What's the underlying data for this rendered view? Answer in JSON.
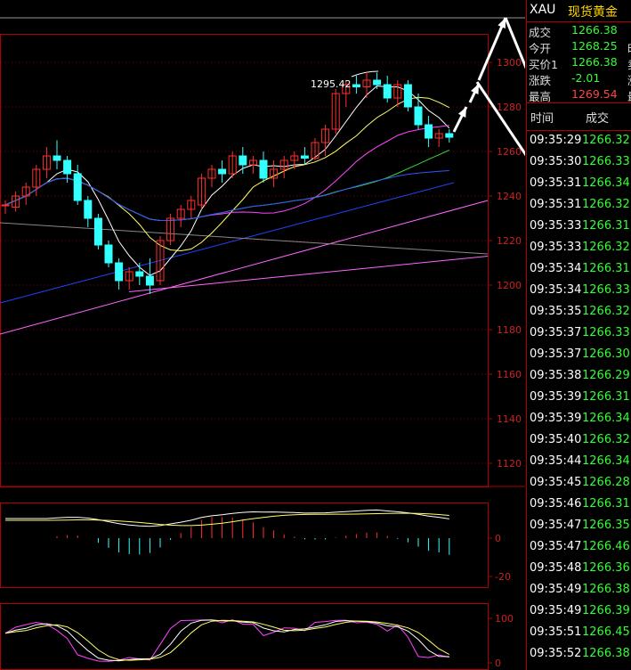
{
  "quote": {
    "symbol": "XAU",
    "name": "现货黄金",
    "rows": [
      {
        "label": "成交",
        "value": "1266.38",
        "extra": "",
        "color": "green"
      },
      {
        "label": "今开",
        "value": "1268.25",
        "extra": "时",
        "color": "green"
      },
      {
        "label": "买价1",
        "value": "1266.38",
        "extra": "卖",
        "color": "green"
      },
      {
        "label": "涨跌",
        "value": "-2.01",
        "extra": "涨",
        "color": "green"
      },
      {
        "label": "最高",
        "value": "1269.54",
        "extra": "最",
        "color": "red"
      }
    ],
    "col_time": "时间",
    "col_price": "成交"
  },
  "ticks": [
    {
      "time": "09:35:29",
      "price": "1266.32"
    },
    {
      "time": "09:35:30",
      "price": "1266.33"
    },
    {
      "time": "09:35:31",
      "price": "1266.34"
    },
    {
      "time": "09:35:31",
      "price": "1266.32"
    },
    {
      "time": "09:35:33",
      "price": "1266.31"
    },
    {
      "time": "09:35:33",
      "price": "1266.32"
    },
    {
      "time": "09:35:34",
      "price": "1266.31"
    },
    {
      "time": "09:35:34",
      "price": "1266.33"
    },
    {
      "time": "09:35:35",
      "price": "1266.32"
    },
    {
      "time": "09:35:37",
      "price": "1266.33"
    },
    {
      "time": "09:35:37",
      "price": "1266.30"
    },
    {
      "time": "09:35:38",
      "price": "1266.29"
    },
    {
      "time": "09:35:39",
      "price": "1266.31"
    },
    {
      "time": "09:35:39",
      "price": "1266.34"
    },
    {
      "time": "09:35:40",
      "price": "1266.32"
    },
    {
      "time": "09:35:44",
      "price": "1266.34"
    },
    {
      "time": "09:35:45",
      "price": "1266.28"
    },
    {
      "time": "09:35:46",
      "price": "1266.31"
    },
    {
      "time": "09:35:47",
      "price": "1266.35"
    },
    {
      "time": "09:35:47",
      "price": "1266.46"
    },
    {
      "time": "09:35:48",
      "price": "1266.36"
    },
    {
      "time": "09:35:49",
      "price": "1266.38"
    },
    {
      "time": "09:35:49",
      "price": "1266.39"
    },
    {
      "time": "09:35:51",
      "price": "1266.45"
    },
    {
      "time": "09:35:52",
      "price": "1266.38"
    }
  ],
  "chart_data": {
    "type": "candlestick",
    "price_axis": {
      "ylim": [
        1110,
        1312
      ],
      "ticks": [
        "1300",
        "1280",
        "1260",
        "1240",
        "1220",
        "1200",
        "1180",
        "1160",
        "1140",
        "1120"
      ]
    },
    "annotation": "1295.42",
    "candles": [
      [
        1236,
        1238,
        1232,
        1236
      ],
      [
        1235,
        1242,
        1233,
        1240
      ],
      [
        1240,
        1246,
        1236,
        1244
      ],
      [
        1244,
        1254,
        1240,
        1252
      ],
      [
        1252,
        1262,
        1248,
        1258
      ],
      [
        1258,
        1265,
        1252,
        1256
      ],
      [
        1256,
        1258,
        1246,
        1250
      ],
      [
        1250,
        1254,
        1236,
        1238
      ],
      [
        1238,
        1240,
        1226,
        1230
      ],
      [
        1230,
        1232,
        1216,
        1218
      ],
      [
        1218,
        1220,
        1208,
        1210
      ],
      [
        1210,
        1212,
        1198,
        1202
      ],
      [
        1202,
        1208,
        1198,
        1206
      ],
      [
        1206,
        1210,
        1200,
        1204
      ],
      [
        1204,
        1212,
        1196,
        1200
      ],
      [
        1202,
        1222,
        1200,
        1220
      ],
      [
        1220,
        1232,
        1218,
        1230
      ],
      [
        1230,
        1236,
        1226,
        1234
      ],
      [
        1234,
        1240,
        1230,
        1238
      ],
      [
        1236,
        1250,
        1234,
        1248
      ],
      [
        1248,
        1254,
        1244,
        1252
      ],
      [
        1252,
        1256,
        1246,
        1250
      ],
      [
        1250,
        1260,
        1248,
        1258
      ],
      [
        1258,
        1262,
        1250,
        1254
      ],
      [
        1254,
        1258,
        1250,
        1256
      ],
      [
        1256,
        1260,
        1246,
        1248
      ],
      [
        1248,
        1256,
        1244,
        1252
      ],
      [
        1252,
        1258,
        1248,
        1256
      ],
      [
        1256,
        1260,
        1252,
        1258
      ],
      [
        1258,
        1262,
        1254,
        1257
      ],
      [
        1257,
        1266,
        1256,
        1264
      ],
      [
        1264,
        1272,
        1258,
        1270
      ],
      [
        1270,
        1288,
        1268,
        1286
      ],
      [
        1286,
        1292,
        1280,
        1290
      ],
      [
        1290,
        1294,
        1286,
        1289
      ],
      [
        1289,
        1296,
        1284,
        1292
      ],
      [
        1292,
        1295.42,
        1288,
        1290
      ],
      [
        1290,
        1294,
        1282,
        1284
      ],
      [
        1284,
        1292,
        1280,
        1290
      ],
      [
        1290,
        1292,
        1278,
        1280
      ],
      [
        1280,
        1286,
        1270,
        1272
      ],
      [
        1272,
        1276,
        1262,
        1266
      ],
      [
        1266,
        1270,
        1262,
        1268
      ],
      [
        1268,
        1270,
        1264,
        1266.38
      ]
    ],
    "macd_axis": {
      "ticks": [
        "0",
        "-20"
      ]
    },
    "kdj_axis": {
      "ticks": [
        "100",
        "0"
      ]
    }
  }
}
